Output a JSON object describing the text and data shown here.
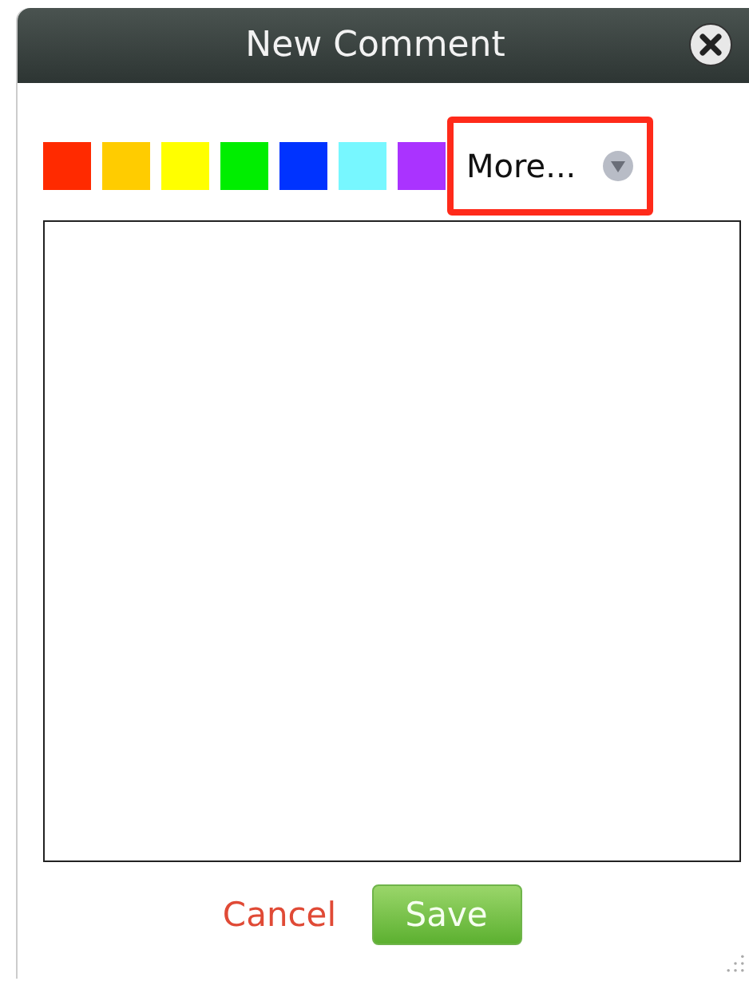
{
  "window": {
    "title": "New Comment"
  },
  "swatches": [
    {
      "color": "#ff2a00"
    },
    {
      "color": "#ffcc00"
    },
    {
      "color": "#ffff00"
    },
    {
      "color": "#00ee00"
    },
    {
      "color": "#0033ff"
    },
    {
      "color": "#77f7ff"
    },
    {
      "color": "#aa33ff"
    }
  ],
  "more": {
    "label": "More...",
    "highlighted": true
  },
  "buttons": [
    {
      "kind": "link",
      "label": "Cancel"
    },
    {
      "kind": "primary",
      "label": "Save"
    }
  ]
}
